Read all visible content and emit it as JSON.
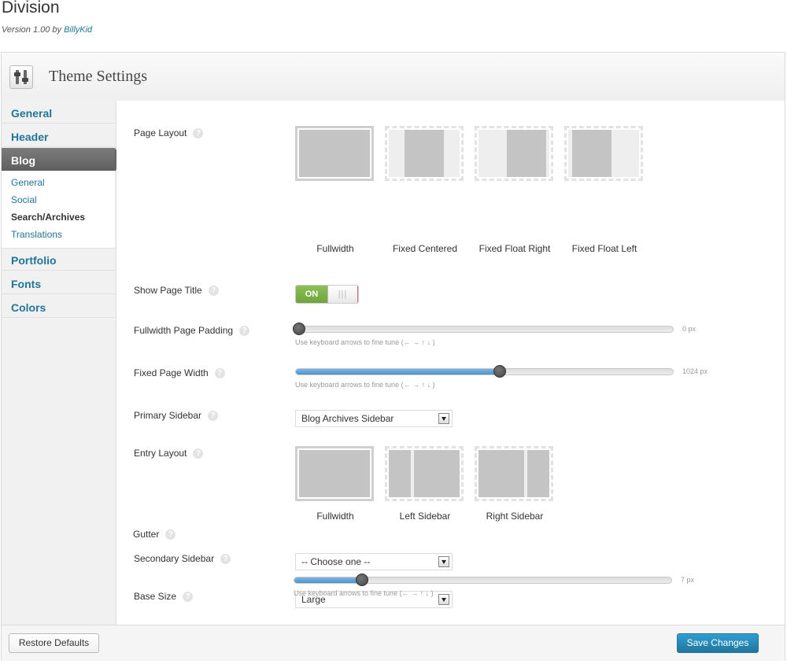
{
  "theme": {
    "name": "Division",
    "version_prefix": "Version 1.00 by ",
    "author": "BillyKid"
  },
  "panel": {
    "title": "Theme Settings",
    "header_icon": "sliders-icon"
  },
  "sidebar": {
    "items": [
      {
        "label": "General"
      },
      {
        "label": "Header"
      },
      {
        "label": "Blog"
      },
      {
        "label": "Portfolio"
      },
      {
        "label": "Fonts"
      },
      {
        "label": "Colors"
      }
    ],
    "active": "Blog",
    "subitems": [
      {
        "label": "General"
      },
      {
        "label": "Social"
      },
      {
        "label": "Search/Archives"
      },
      {
        "label": "Translations"
      }
    ],
    "current_subitem": "Search/Archives"
  },
  "help_glyph": "?",
  "fields": {
    "page_layout": {
      "label": "Page Layout",
      "options": [
        "Fullwidth",
        "Fixed Centered",
        "Fixed Float Right",
        "Fixed Float Left"
      ],
      "selected": "Fullwidth"
    },
    "show_page_title": {
      "label": "Show Page Title",
      "state": "ON",
      "grip": "|||"
    },
    "fullwidth_padding": {
      "label": "Fullwidth Page Padding",
      "value": "0 px",
      "fraction": 0.0,
      "hint": "Use keyboard arrows to fine tune (← → ↑ ↓ )"
    },
    "fixed_page_width": {
      "label": "Fixed Page Width",
      "value": "1024 px",
      "fraction": 0.54,
      "hint": "Use keyboard arrows to fine tune (← → ↑ ↓ )"
    },
    "primary_sidebar": {
      "label": "Primary Sidebar",
      "value": "Blog Archives Sidebar"
    },
    "entry_layout": {
      "label": "Entry Layout",
      "options": [
        "Fullwidth",
        "Left Sidebar",
        "Right Sidebar"
      ],
      "selected": "Fullwidth"
    },
    "secondary_sidebar": {
      "label": "Secondary Sidebar",
      "value": "-- Choose one --"
    },
    "base_size": {
      "label": "Base Size",
      "value": "Large"
    },
    "gutter": {
      "label": "Gutter",
      "value": "7 px",
      "fraction": 0.18,
      "hint": "Use keyboard arrows to fine tune (← → ↑ ↓ )"
    }
  },
  "footer": {
    "restore_label": "Restore Defaults",
    "save_label": "Save Changes"
  },
  "colors": {
    "link": "#21759b",
    "accent_blue": "#4a93cf",
    "toggle_on": "#7ab34a"
  }
}
